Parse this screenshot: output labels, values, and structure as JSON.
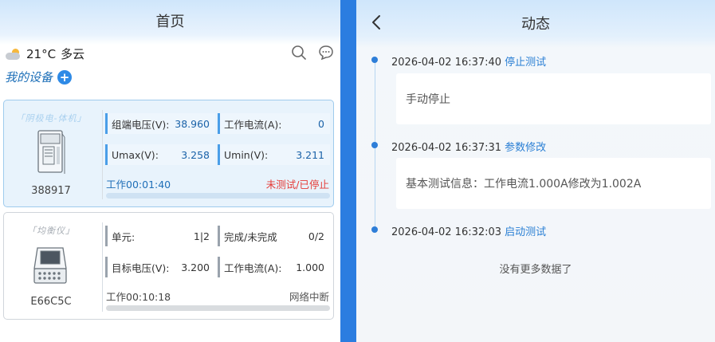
{
  "home": {
    "title": "首页",
    "weather": {
      "temp": "21°C",
      "condition": "多云"
    },
    "my_devices_label": "我的设备",
    "devices": [
      {
        "tag": "「阴极电-体机」",
        "id": "388917",
        "cells": [
          {
            "label": "组端电压(V):",
            "value": "38.960"
          },
          {
            "label": "工作电流(A):",
            "value": "0"
          },
          {
            "label": "Umax(V):",
            "value": "3.258"
          },
          {
            "label": "Umin(V):",
            "value": "3.211"
          }
        ],
        "work_time": "工作00:01:40",
        "status": "未测试/已停止",
        "progress": 0
      },
      {
        "tag": "「均衡仪」",
        "id": "E66C5C",
        "cells": [
          {
            "label": "单元:",
            "value": "1|2"
          },
          {
            "label": "完成/未完成",
            "value": "0/2"
          },
          {
            "label": "目标电压(V):",
            "value": "3.200"
          },
          {
            "label": "工作电流(A):",
            "value": "1.000"
          }
        ],
        "work_time": "工作00:10:18",
        "status": "网络中断",
        "progress": 0
      }
    ]
  },
  "activity": {
    "title": "动态",
    "back_glyph": "‹",
    "events": [
      {
        "datetime": "2026-04-02 16:37:40",
        "action": "停止测试",
        "detail": "手动停止"
      },
      {
        "datetime": "2026-04-02 16:37:31",
        "action": "参数修改",
        "detail": "基本测试信息：工作电流1.000A修改为1.002A"
      },
      {
        "datetime": "2026-04-02 16:32:03",
        "action": "启动测试",
        "detail": ""
      }
    ],
    "no_more": "没有更多数据了"
  },
  "icons": {
    "weather": "partly-cloudy-icon",
    "search": "search-icon",
    "message": "chat-bubble-icon",
    "add": "plus-circle-icon",
    "back": "chevron-left-icon"
  },
  "colors": {
    "accent": "#2e8ae6",
    "divider": "#2b7de0",
    "alert": "#e53935"
  }
}
